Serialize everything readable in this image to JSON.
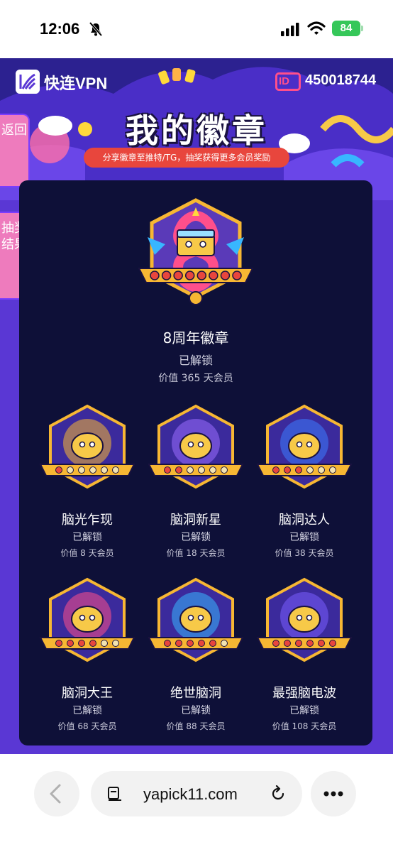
{
  "status_bar": {
    "time": "12:06",
    "battery": "84"
  },
  "header": {
    "app_name": "快连VPN",
    "id_label": "ID",
    "user_id": "450018744",
    "title": "我的徽章",
    "subtitle": "分享徽章至推特/TG，抽奖获得更多会员奖励"
  },
  "side_tabs": {
    "back": "返回",
    "lottery_results": "抽奖结果"
  },
  "featured_badge": {
    "name": "8周年徽章",
    "status": "已解锁",
    "value": "价值 365 天会员",
    "stars": 8
  },
  "badges": [
    {
      "name": "脑光乍现",
      "status": "已解锁",
      "value": "价值 8 天会员",
      "stars": 1,
      "accent": "#f7b733"
    },
    {
      "name": "脑洞新星",
      "status": "已解锁",
      "value": "价值 18 天会员",
      "stars": 2,
      "accent": "#9a6bff"
    },
    {
      "name": "脑洞达人",
      "status": "已解锁",
      "value": "价值 38 天会员",
      "stars": 3,
      "accent": "#3c7bff"
    },
    {
      "name": "脑洞大王",
      "status": "已解锁",
      "value": "价值 68 天会员",
      "stars": 4,
      "accent": "#ff4f8b"
    },
    {
      "name": "绝世脑洞",
      "status": "已解锁",
      "value": "价值 88 天会员",
      "stars": 5,
      "accent": "#38b6ff"
    },
    {
      "name": "最强脑电波",
      "status": "已解锁",
      "value": "价值 108 天会员",
      "stars": 6,
      "accent": "#7a5cff"
    }
  ],
  "browser": {
    "url": "yapick11.com"
  },
  "icons": {
    "bell": "bell-slash-icon",
    "signal": "cellular-signal-icon",
    "wifi": "wifi-icon",
    "back": "chevron-left-icon",
    "tabs": "document-icon",
    "reload": "reload-icon",
    "more": "ellipsis-icon"
  },
  "colors": {
    "primary": "#5a37d4",
    "panel": "#0e1038",
    "tab": "#ee7bbd",
    "subtitle_bg": "#e8463d"
  }
}
